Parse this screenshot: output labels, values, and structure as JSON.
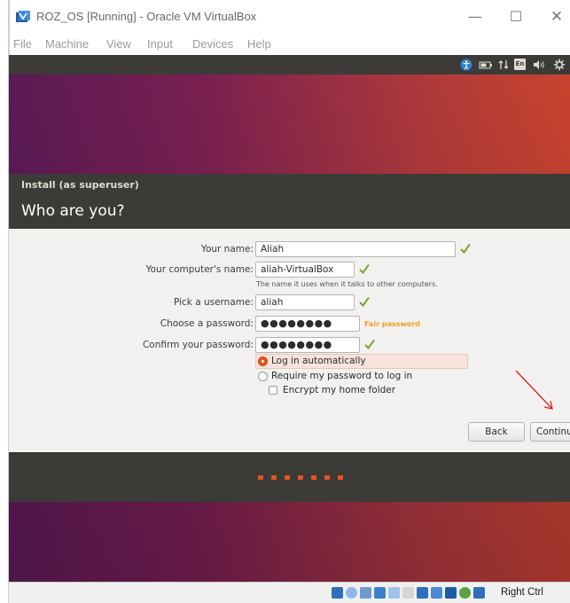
{
  "window": {
    "title": "ROZ_OS [Running] - Oracle VM VirtualBox",
    "min_glyph": "—",
    "max_glyph": "☐",
    "close_glyph": "✕"
  },
  "menu": [
    "File",
    "Machine",
    "View",
    "Input",
    "Devices",
    "Help"
  ],
  "guest_tray": {
    "icons": [
      "accessibility-icon",
      "battery-icon",
      "network-icon",
      "keyboard-layout-icon",
      "volume-icon",
      "gear-icon"
    ],
    "keyboard_layout": "En"
  },
  "installer": {
    "window_title": "Install (as superuser)",
    "heading": "Who are you?",
    "fields": {
      "your_name_label": "Your name:",
      "your_name_value": "Aliah",
      "computer_name_label": "Your computer's name:",
      "computer_name_value": "aliah-VirtualBox",
      "computer_name_hint": "The name it uses when it talks to other computers.",
      "username_label": "Pick a username:",
      "username_value": "aliah",
      "password_label": "Choose a password:",
      "password_value": "●●●●●●●●",
      "password_strength": "Fair password",
      "confirm_label": "Confirm your password:",
      "confirm_value": "●●●●●●●●"
    },
    "options": {
      "login_auto": "Log in automatically",
      "require_password": "Require my password to log in",
      "encrypt_home": "Encrypt my home folder",
      "selected": "login_auto"
    },
    "buttons": {
      "back": "Back",
      "continue": "Continue"
    },
    "progress": {
      "steps": 7
    }
  },
  "statusbar": {
    "host_key": "Right Ctrl"
  },
  "colors": {
    "ubuntu_orange": "#e95420",
    "panel_dark": "#3c3b37",
    "valid_check": "#7aa52e",
    "fair_password": "#f19e1d",
    "annotation_red": "#e02020"
  }
}
